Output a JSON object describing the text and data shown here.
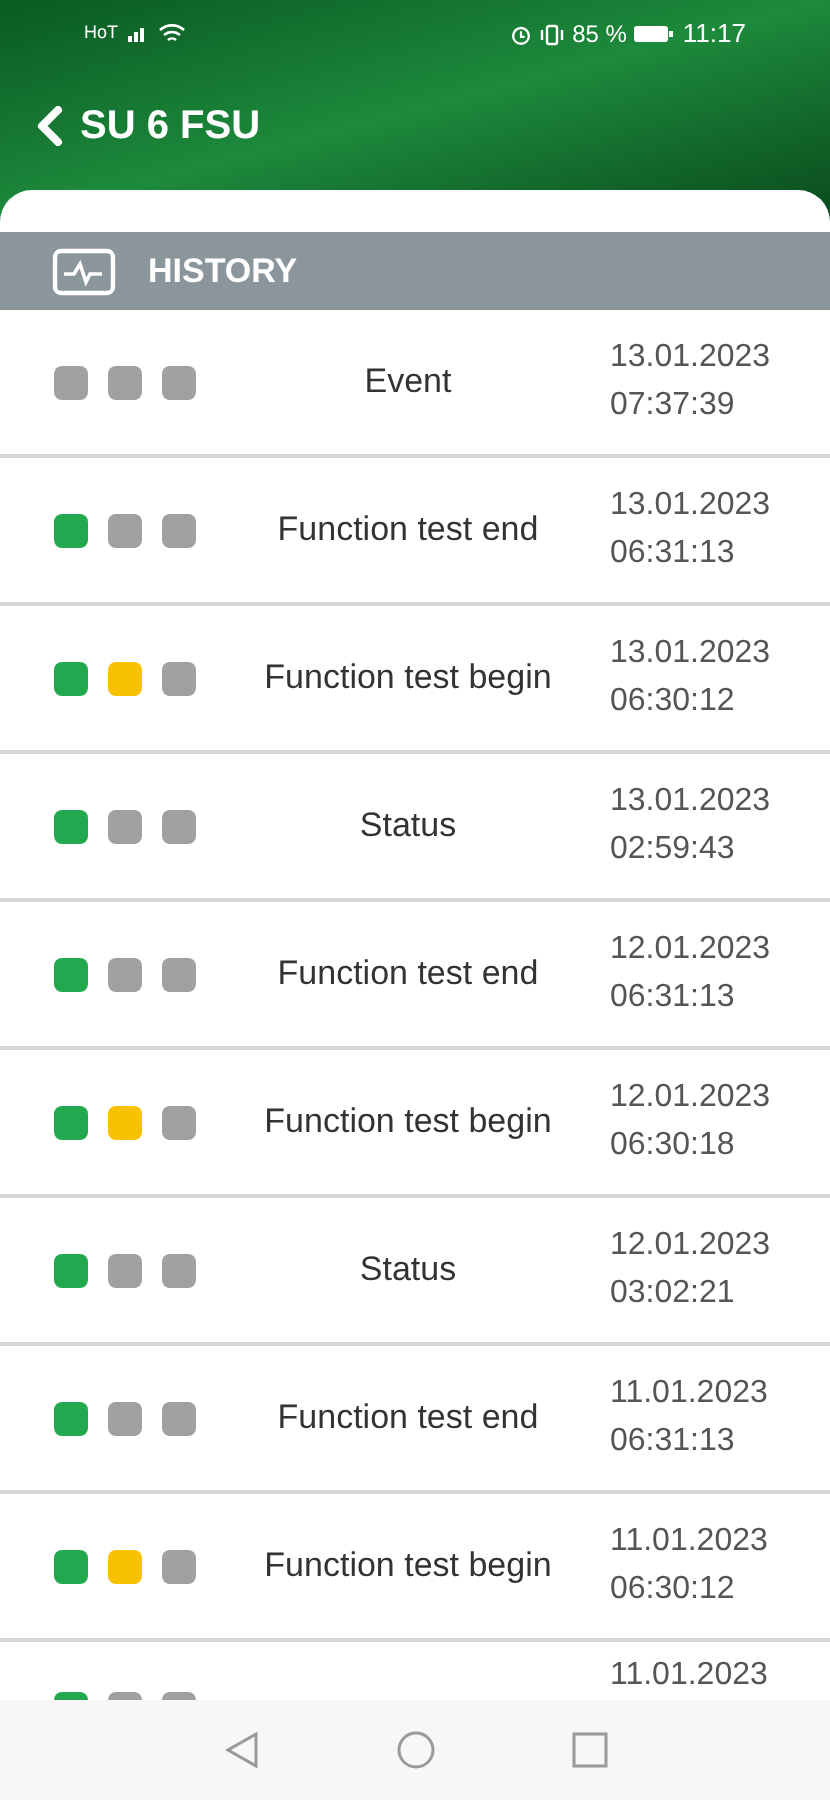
{
  "status_bar": {
    "carrier": "HoT",
    "battery": "85 %",
    "time": "11:17"
  },
  "header": {
    "title": "SU 6 FSU"
  },
  "section": {
    "title": "HISTORY"
  },
  "rows": [
    {
      "lights": [
        {
          "color": "#a0a0a0"
        },
        {
          "color": "#a0a0a0"
        },
        {
          "color": "#a0a0a0"
        }
      ],
      "label": "Event",
      "date": "13.01.2023",
      "time": "07:37:39"
    },
    {
      "lights": [
        {
          "color": "#22a94f"
        },
        {
          "color": "#a0a0a0"
        },
        {
          "color": "#a0a0a0"
        }
      ],
      "label": "Function test end",
      "date": "13.01.2023",
      "time": "06:31:13"
    },
    {
      "lights": [
        {
          "color": "#22a94f"
        },
        {
          "color": "#f9c200"
        },
        {
          "color": "#a0a0a0"
        }
      ],
      "label": "Function test begin",
      "date": "13.01.2023",
      "time": "06:30:12"
    },
    {
      "lights": [
        {
          "color": "#22a94f"
        },
        {
          "color": "#a0a0a0"
        },
        {
          "color": "#a0a0a0"
        }
      ],
      "label": "Status",
      "date": "13.01.2023",
      "time": "02:59:43"
    },
    {
      "lights": [
        {
          "color": "#22a94f"
        },
        {
          "color": "#a0a0a0"
        },
        {
          "color": "#a0a0a0"
        }
      ],
      "label": "Function test end",
      "date": "12.01.2023",
      "time": "06:31:13"
    },
    {
      "lights": [
        {
          "color": "#22a94f"
        },
        {
          "color": "#f9c200"
        },
        {
          "color": "#a0a0a0"
        }
      ],
      "label": "Function test begin",
      "date": "12.01.2023",
      "time": "06:30:18"
    },
    {
      "lights": [
        {
          "color": "#22a94f"
        },
        {
          "color": "#a0a0a0"
        },
        {
          "color": "#a0a0a0"
        }
      ],
      "label": "Status",
      "date": "12.01.2023",
      "time": "03:02:21"
    },
    {
      "lights": [
        {
          "color": "#22a94f"
        },
        {
          "color": "#a0a0a0"
        },
        {
          "color": "#a0a0a0"
        }
      ],
      "label": "Function test end",
      "date": "11.01.2023",
      "time": "06:31:13"
    },
    {
      "lights": [
        {
          "color": "#22a94f"
        },
        {
          "color": "#f9c200"
        },
        {
          "color": "#a0a0a0"
        }
      ],
      "label": "Function test begin",
      "date": "11.01.2023",
      "time": "06:30:12"
    },
    {
      "lights": [
        {
          "color": "#22a94f"
        },
        {
          "color": "#a0a0a0"
        },
        {
          "color": "#a0a0a0"
        }
      ],
      "date": "11.01.2023"
    }
  ]
}
